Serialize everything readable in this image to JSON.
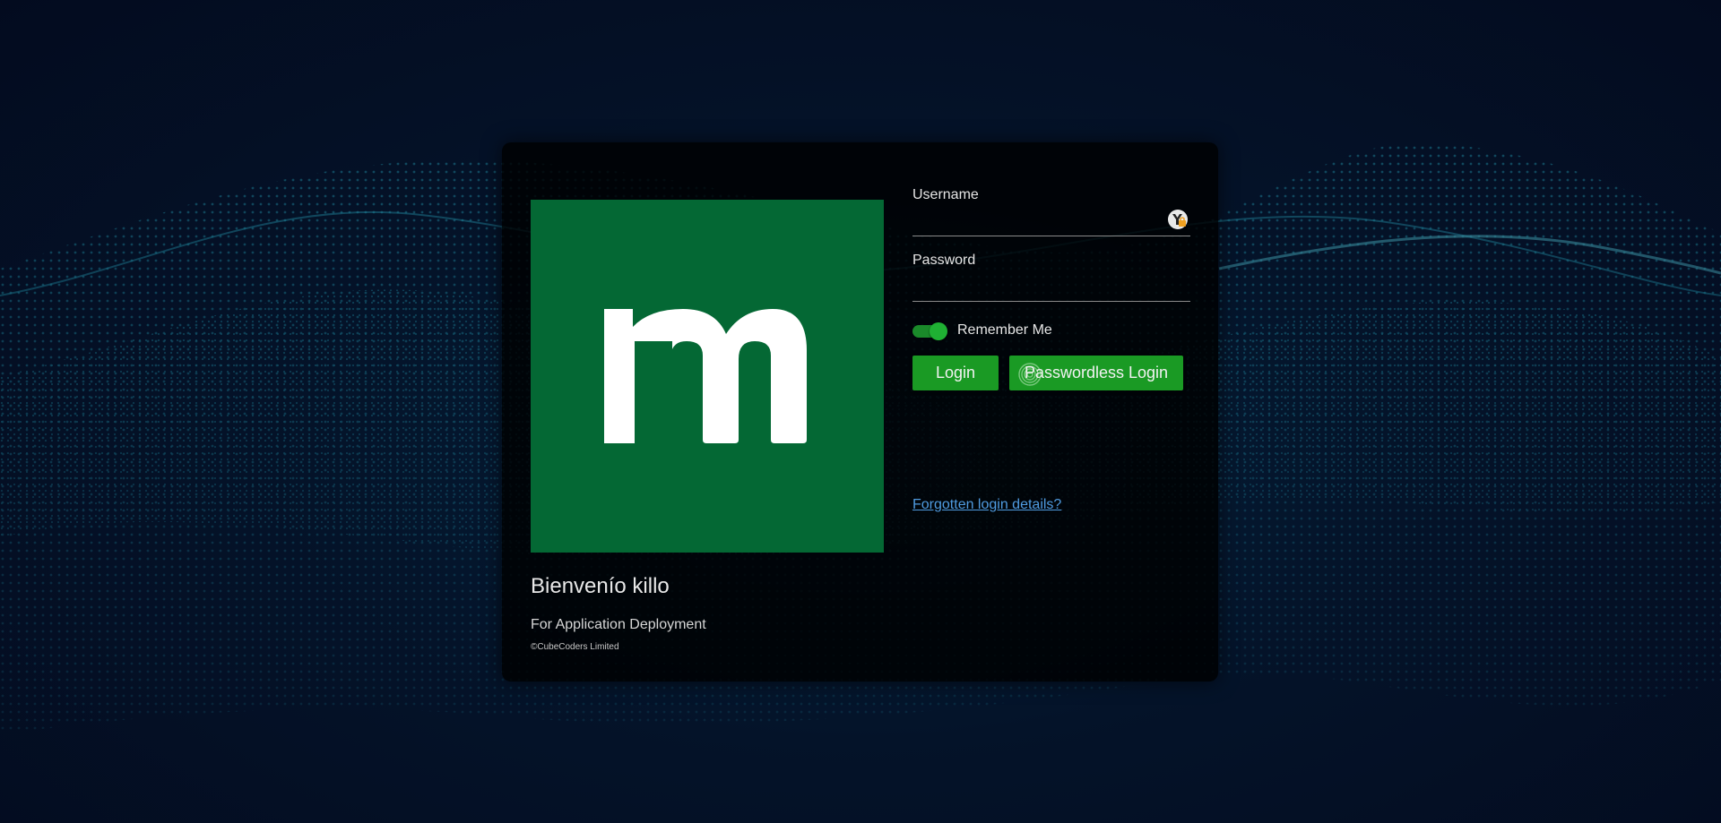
{
  "brand": {
    "logo_letter": "m",
    "logo_color": "#046834"
  },
  "welcome": {
    "title": "Bienvenío killo",
    "subtitle": "For Application Deployment",
    "copyright": "©CubeCoders Limited"
  },
  "form": {
    "username_label": "Username",
    "username_value": "",
    "password_label": "Password",
    "password_value": "",
    "remember_label": "Remember Me",
    "remember_checked": true,
    "login_label": "Login",
    "passwordless_label": "Passwordless Login",
    "forgot_label": "Forgotten login details?"
  },
  "icons": {
    "password_manager": "password-manager-icon",
    "fingerprint": "fingerprint-icon"
  },
  "colors": {
    "accent_green": "#1a9a24",
    "link_blue": "#4f9be0",
    "card_bg": "#000000"
  }
}
